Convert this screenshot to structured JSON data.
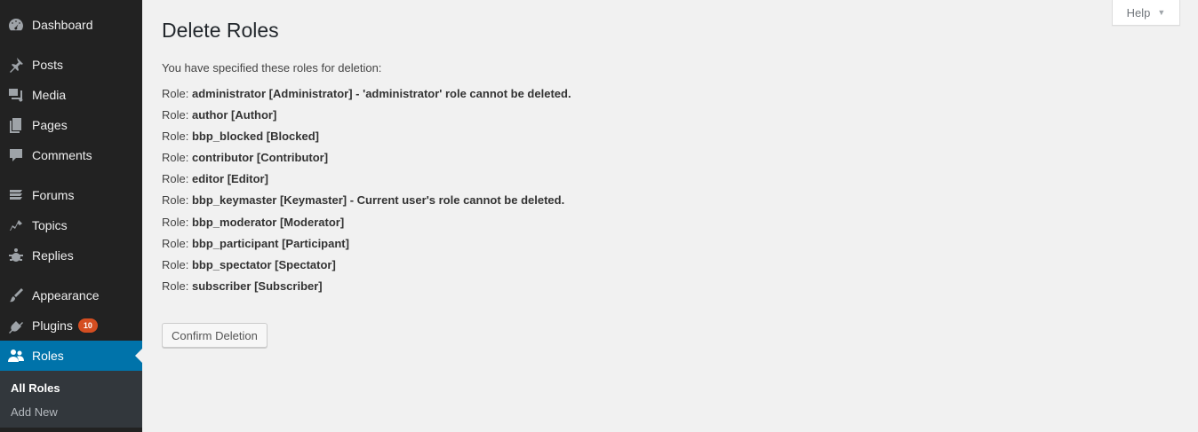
{
  "sidebar": {
    "items": [
      {
        "label": "Dashboard",
        "icon": "dashboard-icon"
      },
      {
        "label": "Posts",
        "icon": "pin-icon"
      },
      {
        "label": "Media",
        "icon": "media-icon"
      },
      {
        "label": "Pages",
        "icon": "pages-icon"
      },
      {
        "label": "Comments",
        "icon": "comment-icon"
      },
      {
        "label": "Forums",
        "icon": "forums-icon"
      },
      {
        "label": "Topics",
        "icon": "topics-icon"
      },
      {
        "label": "Replies",
        "icon": "replies-icon"
      },
      {
        "label": "Appearance",
        "icon": "brush-icon"
      },
      {
        "label": "Plugins",
        "icon": "plug-icon",
        "badge": "10"
      },
      {
        "label": "Roles",
        "icon": "users-icon"
      }
    ],
    "submenu": [
      {
        "label": "All Roles"
      },
      {
        "label": "Add New"
      }
    ]
  },
  "help": {
    "label": "Help"
  },
  "main": {
    "title": "Delete Roles",
    "intro": "You have specified these roles for deletion:",
    "role_prefix": "Role:",
    "roles": [
      {
        "text": "administrator [Administrator] - 'administrator' role cannot be deleted."
      },
      {
        "text": "author [Author]"
      },
      {
        "text": "bbp_blocked [Blocked]"
      },
      {
        "text": "contributor [Contributor]"
      },
      {
        "text": "editor [Editor]"
      },
      {
        "text": "bbp_keymaster [Keymaster] - Current user's role cannot be deleted."
      },
      {
        "text": "bbp_moderator [Moderator]"
      },
      {
        "text": "bbp_participant [Participant]"
      },
      {
        "text": "bbp_spectator [Spectator]"
      },
      {
        "text": "subscriber [Subscriber]"
      }
    ],
    "confirm_label": "Confirm Deletion"
  },
  "colors": {
    "sidebar_bg": "#222222",
    "active_bg": "#0073aa",
    "badge_bg": "#d54e21",
    "page_bg": "#f1f1f1"
  }
}
